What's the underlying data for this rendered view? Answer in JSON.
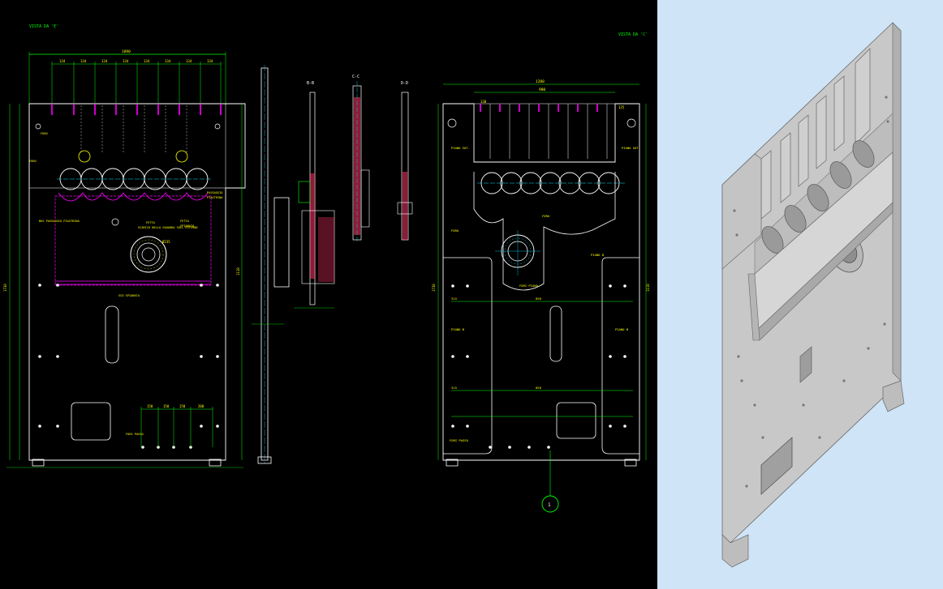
{
  "cad_view": {
    "view_labels": {
      "left_view": "VISTA DA 'E'",
      "right_view": "VISTA DA 'C'",
      "section_b": "B-B",
      "section_c": "C-C",
      "section_d": "D-D",
      "balloon": "1"
    },
    "left_dims": {
      "overall_width": "1890",
      "pitch_1": "134",
      "pitch_2": "134",
      "pitch_3": "134",
      "pitch_4": "134",
      "pitch_5": "134",
      "pitch_6": "134",
      "pitch_7": "134",
      "pitch_8": "134",
      "height_total": "1730",
      "height_mid": "1110",
      "bottom_1": "150",
      "bottom_2": "150",
      "bottom_3": "150",
      "bottom_4": "200"
    },
    "left_notes": {
      "hole_note_a": "FORO",
      "hole_note_b": "FORO",
      "left_note": "BUS PASSAGGIO PIASTRINA",
      "center_note_a": "FETTA",
      "center_note_b": "SCARICO NELLA SQUADRA SULL'ESTERNO",
      "right_note_a": "FETTA",
      "right_note_b": "SPIANATA",
      "right_top_note_a": "PASSAGGIO",
      "right_top_note_b": "PIASTRINA",
      "groove_note": "SCD SPIANATA",
      "bottom_note": "FORI PASSO",
      "bore_note": "Ø235"
    },
    "right_dims": {
      "overall_width": "1200",
      "inner_width": "980",
      "pitch_1": "130",
      "right_small": "125",
      "pin_label_left": "PIANO SOT.",
      "pin_label_right": "PIANO SOT.",
      "hole_note_a": "FORO",
      "hole_note_b": "FORO",
      "slot_note": "FORI PIANO",
      "mid_note": "PIANO B",
      "dim_left_a": "315",
      "dim_left_b": "858",
      "dim_left_c": "315",
      "dim_left_d": "858",
      "bottom_note": "FORI PASSO",
      "height_a": "1730",
      "height_b": "1110",
      "plane_left": "PIANO B",
      "plane_right": "PIANO B"
    }
  },
  "colors": {
    "cad_background": "#000000",
    "model_background": "#cfe4f6",
    "outline": "#ffffff",
    "dimension": "#00ff00",
    "centerline": "#00e5ff",
    "section_hatch": "#ff3366",
    "hidden": "#ff00ff",
    "note": "#ffff00"
  },
  "model_view": {
    "icon": "3d-part-model"
  }
}
